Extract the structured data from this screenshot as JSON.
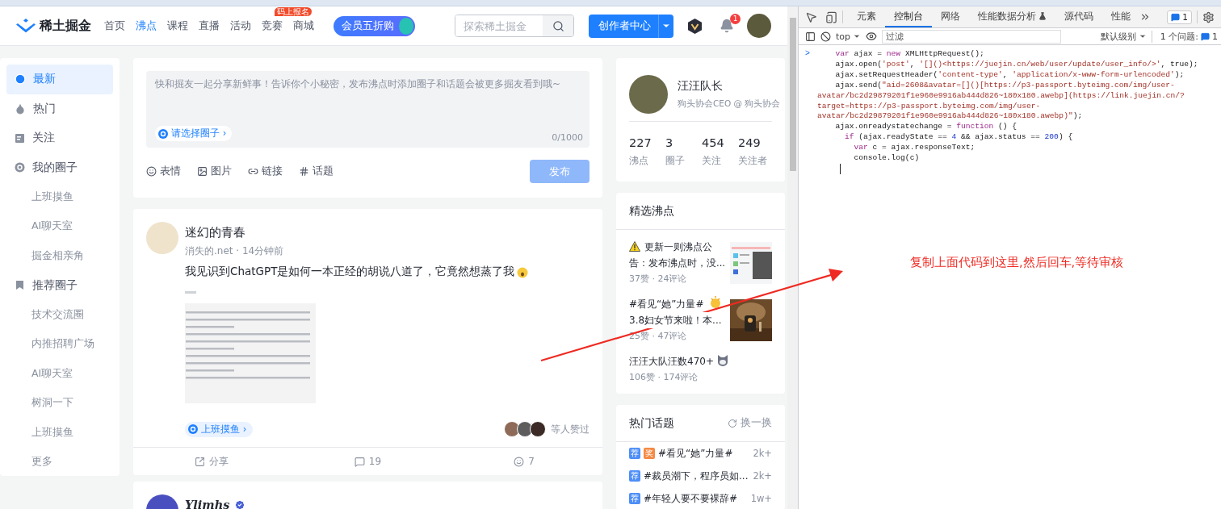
{
  "header": {
    "logo": "稀土掘金",
    "nav": [
      {
        "label": "首页",
        "selected": false
      },
      {
        "label": "沸点",
        "selected": true
      },
      {
        "label": "课程",
        "selected": false
      },
      {
        "label": "直播",
        "selected": false
      },
      {
        "label": "活动",
        "selected": false
      },
      {
        "label": "竞赛",
        "selected": false,
        "badge": "码上报名"
      },
      {
        "label": "商城",
        "selected": false
      }
    ],
    "promo": "会员五折购",
    "search": {
      "placeholder": "探索稀土掘金"
    },
    "creator_button": "创作者中心",
    "notification_count": "1"
  },
  "sidebar": {
    "items": [
      {
        "label": "最新",
        "selected": true
      },
      {
        "label": "热门",
        "selected": false
      },
      {
        "label": "关注",
        "selected": false
      },
      {
        "label": "我的圈子",
        "selected": false,
        "children": [
          {
            "label": "上班摸鱼",
            "selected": false
          },
          {
            "label": "AI聊天室",
            "selected": false
          },
          {
            "label": "掘金相亲角",
            "selected": false
          }
        ]
      },
      {
        "label": "推荐圈子",
        "selected": false,
        "children": [
          {
            "label": "技术交流圈",
            "selected": false
          },
          {
            "label": "内推招聘广场",
            "selected": false
          },
          {
            "label": "AI聊天室",
            "selected": false
          },
          {
            "label": "树洞一下",
            "selected": false
          },
          {
            "label": "上班摸鱼",
            "selected": false
          },
          {
            "label": "更多",
            "selected": false
          }
        ]
      }
    ]
  },
  "composer": {
    "placeholder": "快和掘友一起分享新鲜事！告诉你个小秘密，发布沸点时添加圈子和话题会被更多掘友看到哦~",
    "circle_picker": "请选择圈子 ›",
    "counter": "0/1000",
    "tools": [
      "表情",
      "图片",
      "链接",
      "话题"
    ],
    "publish": {
      "label": "发布",
      "disabled": true
    }
  },
  "posts": [
    {
      "author": "迷幻的青春",
      "meta": "消失的.net · 14分钟前",
      "text": "我见识到ChatGPT是如何一本正经的胡说八道了，它竟然想蒸了我",
      "tag": "上班摸鱼 ›",
      "likers": "等人赞过",
      "share": "分享",
      "comments": "19",
      "likes": "7"
    },
    {
      "author": "Ylimhs",
      "verified": true
    }
  ],
  "profile": {
    "name": "汪汪队长",
    "title": "狗头协会CEO @ 狗头协会",
    "stats": [
      {
        "value": "227",
        "label": "沸点"
      },
      {
        "value": "3",
        "label": "圈子"
      },
      {
        "value": "454",
        "label": "关注"
      },
      {
        "value": "249",
        "label": "关注者"
      }
    ]
  },
  "featured": {
    "title": "精选沸点",
    "items": [
      {
        "text": "更新一则沸点公告：发布沸点时，没...",
        "stats": "37赞 · 24评论"
      },
      {
        "text": "#看见“她”力量#",
        "text_2": "3.8妇女节来啦！本...",
        "stats": "25赞 · 47评论"
      },
      {
        "text": "汪汪大队汪数470+",
        "stats": "106赞 · 174评论"
      }
    ]
  },
  "topics": {
    "title": "热门话题",
    "refresh": "换一换",
    "items": [
      {
        "tags": [
          {
            "label": "荐",
            "color": "#4d8ef7"
          },
          {
            "label": "奖",
            "color": "#f58a45"
          }
        ],
        "text": "#看见“她”力量#",
        "count": "2k+"
      },
      {
        "tags": [
          {
            "label": "荐",
            "color": "#4d8ef7"
          }
        ],
        "text": "#裁员潮下，程序员如...",
        "count": "2k+"
      },
      {
        "tags": [
          {
            "label": "荐",
            "color": "#4d8ef7"
          }
        ],
        "text": "#年轻人要不要裸辞#",
        "count": "1w+"
      }
    ]
  },
  "devtools": {
    "tabs": [
      {
        "label": "元素",
        "selected": false
      },
      {
        "label": "控制台",
        "selected": true
      },
      {
        "label": "网络",
        "selected": false
      },
      {
        "label": "性能数据分析",
        "selected": false
      },
      {
        "label": "源代码",
        "selected": false
      },
      {
        "label": "性能",
        "selected": false
      }
    ],
    "messages": "1",
    "context": "top",
    "filter": {
      "placeholder": "过滤"
    },
    "level": "默认级别",
    "issues": "1 个问题:",
    "issues_count": "1",
    "prompt": ">",
    "lines": [
      {
        "kind": "statement",
        "tokens": [
          {
            "kind": "kw",
            "t": "  var"
          },
          {
            "kind": "p",
            "t": " ajax = "
          },
          {
            "kind": "kw",
            "t": "new"
          },
          {
            "kind": "p",
            "t": " XMLHttpRequest();"
          }
        ]
      },
      {
        "kind": "statement",
        "tokens": [
          {
            "kind": "p",
            "t": "  ajax.open("
          },
          {
            "kind": "str",
            "t": "'post'"
          },
          {
            "kind": "p",
            "t": ", "
          },
          {
            "kind": "str",
            "t": "'[]()<https://juejin.cn/web/user/update/user_info/>'"
          },
          {
            "kind": "p",
            "t": ", true);"
          }
        ]
      },
      {
        "kind": "statement",
        "tokens": [
          {
            "kind": "p",
            "t": "  ajax.setRequestHeader("
          },
          {
            "kind": "str",
            "t": "'content-type'"
          },
          {
            "kind": "p",
            "t": ", "
          },
          {
            "kind": "str",
            "t": "'application/x-www-form-urlencoded'"
          },
          {
            "kind": "p",
            "t": ");"
          }
        ]
      },
      {
        "kind": "statement",
        "tokens": [
          {
            "kind": "p",
            "t": "  ajax.send("
          },
          {
            "kind": "str",
            "t": "\"aid=2608&avatar=[]()[https://p3-passport.byteimg.com/img/user-"
          }
        ]
      },
      {
        "kind": "continuation",
        "tokens": [
          {
            "kind": "str",
            "t": "avatar/bc2d29879201f1e960e9916ab444d826~180x180.awebp](https://link.juejin.cn/?"
          }
        ]
      },
      {
        "kind": "continuation",
        "tokens": [
          {
            "kind": "str",
            "t": "target=https://p3-passport.byteimg.com/img/user-"
          }
        ]
      },
      {
        "kind": "continuation",
        "tokens": [
          {
            "kind": "str",
            "t": "avatar/bc2d29879201f1e960e9916ab444d826~180x180.awebp)\""
          },
          {
            "kind": "p",
            "t": ");"
          }
        ]
      },
      {
        "kind": "statement",
        "tokens": [
          {
            "kind": "p",
            "t": "  ajax.onreadystatechange = "
          },
          {
            "kind": "kw",
            "t": "function"
          },
          {
            "kind": "p",
            "t": " () {"
          }
        ]
      },
      {
        "kind": "statement",
        "tokens": [
          {
            "kind": "kw",
            "t": "    if"
          },
          {
            "kind": "p",
            "t": " (ajax.readyState == "
          },
          {
            "kind": "num",
            "t": "4"
          },
          {
            "kind": "p",
            "t": " && ajax.status == "
          },
          {
            "kind": "num",
            "t": "200"
          },
          {
            "kind": "p",
            "t": ") {"
          }
        ]
      },
      {
        "kind": "statement",
        "tokens": [
          {
            "kind": "kw",
            "t": "      var"
          },
          {
            "kind": "p",
            "t": " c = ajax.responseText;"
          }
        ]
      },
      {
        "kind": "statement",
        "tokens": [
          {
            "kind": "p",
            "t": "      console.log(c)"
          }
        ]
      }
    ]
  },
  "annotation": "复制上面代码到这里,然后回车,等待审核"
}
